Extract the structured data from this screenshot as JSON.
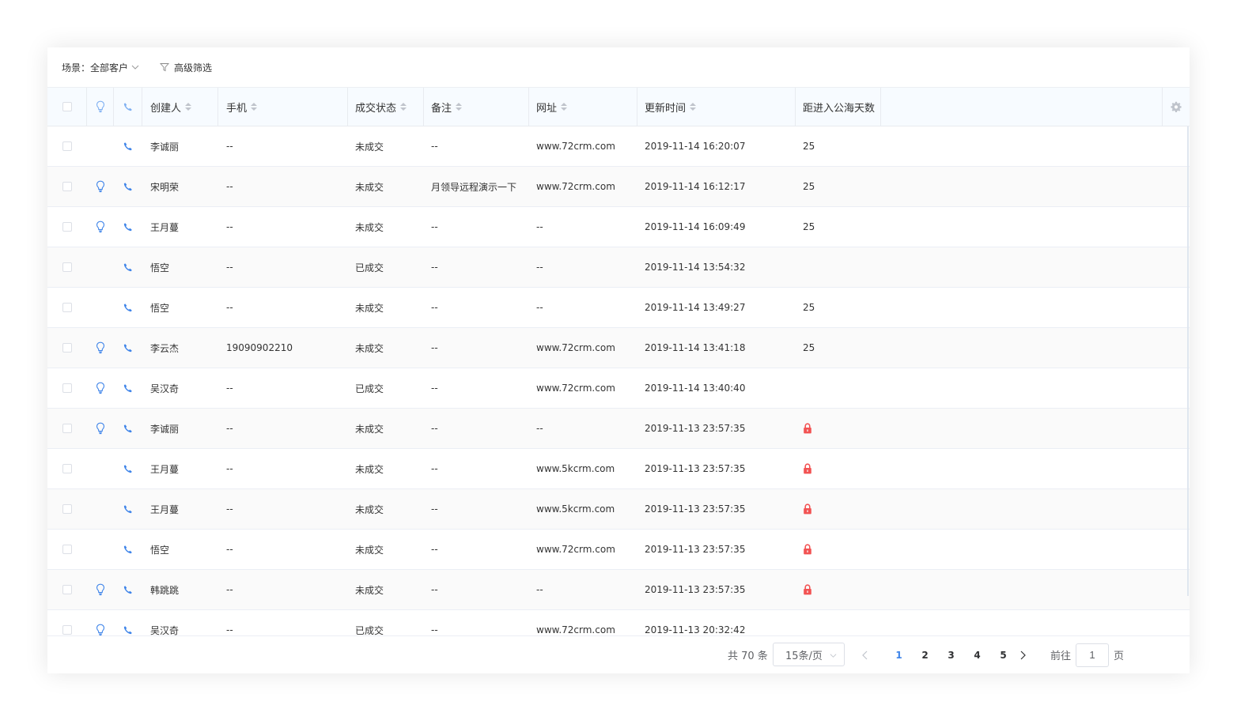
{
  "toolbar": {
    "scene_label": "场景：",
    "scene_value": "全部客户",
    "filter_label": "高级筛选"
  },
  "columns": [
    "创建人",
    "手机",
    "成交状态",
    "备注",
    "网址",
    "更新时间",
    "距进入公海天数"
  ],
  "rows": [
    {
      "bulb": false,
      "creator": "李诚丽",
      "phone": "--",
      "status": "未成交",
      "note": "--",
      "url": "www.72crm.com",
      "updated": "2019-11-14 16:20:07",
      "days": "25",
      "locked": false
    },
    {
      "bulb": true,
      "creator": "宋明荣",
      "phone": "--",
      "status": "未成交",
      "note": "月领导远程演示一下",
      "url": "www.72crm.com",
      "updated": "2019-11-14 16:12:17",
      "days": "25",
      "locked": false
    },
    {
      "bulb": true,
      "creator": "王月蔓",
      "phone": "--",
      "status": "未成交",
      "note": "--",
      "url": "--",
      "updated": "2019-11-14 16:09:49",
      "days": "25",
      "locked": false
    },
    {
      "bulb": false,
      "creator": "悟空",
      "phone": "--",
      "status": "已成交",
      "note": "--",
      "url": "--",
      "updated": "2019-11-14 13:54:32",
      "days": "",
      "locked": false
    },
    {
      "bulb": false,
      "creator": "悟空",
      "phone": "--",
      "status": "未成交",
      "note": "--",
      "url": "--",
      "updated": "2019-11-14 13:49:27",
      "days": "25",
      "locked": false
    },
    {
      "bulb": true,
      "creator": "李云杰",
      "phone": "19090902210",
      "status": "未成交",
      "note": "--",
      "url": "www.72crm.com",
      "updated": "2019-11-14 13:41:18",
      "days": "25",
      "locked": false
    },
    {
      "bulb": true,
      "creator": "吴汉奇",
      "phone": "--",
      "status": "已成交",
      "note": "--",
      "url": "www.72crm.com",
      "updated": "2019-11-14 13:40:40",
      "days": "",
      "locked": false
    },
    {
      "bulb": true,
      "creator": "李诚丽",
      "phone": "--",
      "status": "未成交",
      "note": "--",
      "url": "--",
      "updated": "2019-11-13 23:57:35",
      "days": "",
      "locked": true
    },
    {
      "bulb": false,
      "creator": "王月蔓",
      "phone": "--",
      "status": "未成交",
      "note": "--",
      "url": "www.5kcrm.com",
      "updated": "2019-11-13 23:57:35",
      "days": "",
      "locked": true
    },
    {
      "bulb": false,
      "creator": "王月蔓",
      "phone": "--",
      "status": "未成交",
      "note": "--",
      "url": "www.5kcrm.com",
      "updated": "2019-11-13 23:57:35",
      "days": "",
      "locked": true
    },
    {
      "bulb": false,
      "creator": "悟空",
      "phone": "--",
      "status": "未成交",
      "note": "--",
      "url": "www.72crm.com",
      "updated": "2019-11-13 23:57:35",
      "days": "",
      "locked": true
    },
    {
      "bulb": true,
      "creator": "韩跳跳",
      "phone": "--",
      "status": "未成交",
      "note": "--",
      "url": "--",
      "updated": "2019-11-13 23:57:35",
      "days": "",
      "locked": true
    },
    {
      "bulb": true,
      "creator": "吴汉奇",
      "phone": "--",
      "status": "已成交",
      "note": "--",
      "url": "www.72crm.com",
      "updated": "2019-11-13 20:32:42",
      "days": "",
      "locked": false
    }
  ],
  "footer": {
    "total_text": "共 70 条",
    "page_size": "15条/页",
    "pages": [
      "1",
      "2",
      "3",
      "4",
      "5"
    ],
    "current_page": "1",
    "goto_label": "前往",
    "goto_value": "1",
    "goto_suffix": "页"
  },
  "colors": {
    "accent": "#3e84e9",
    "lock": "#f25353",
    "header_bg": "#f7fbff"
  }
}
